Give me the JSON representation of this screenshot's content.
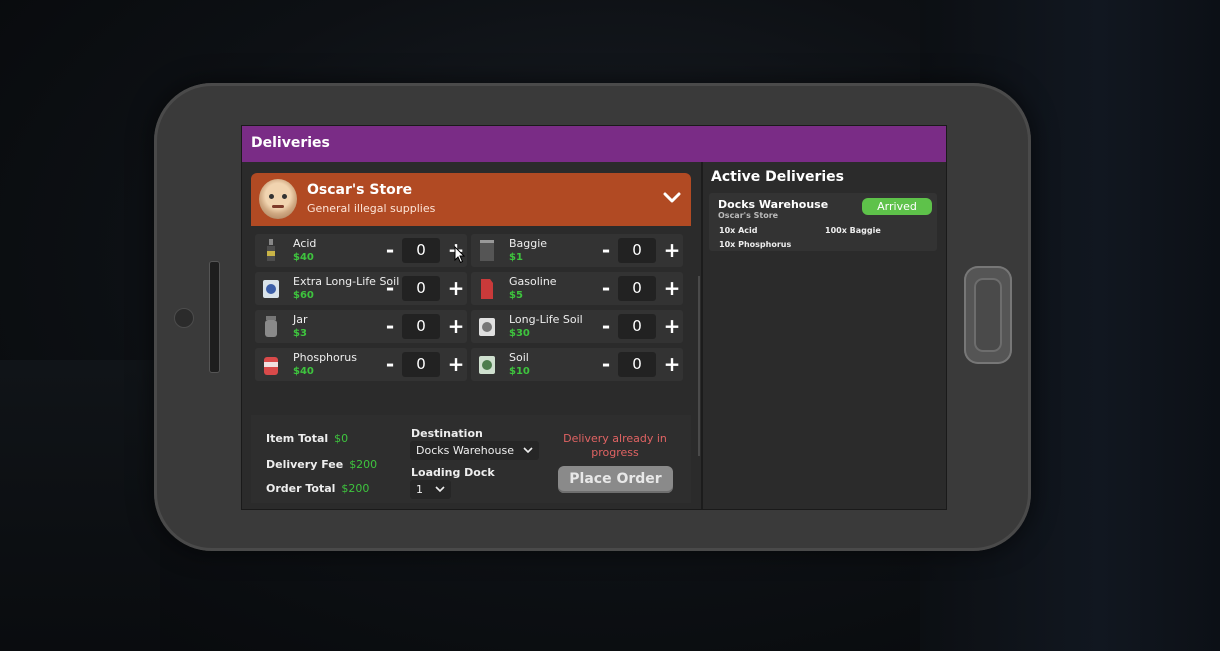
{
  "app": {
    "title": "Deliveries"
  },
  "store": {
    "name": "Oscar's Store",
    "description": "General illegal supplies"
  },
  "items": [
    {
      "name": "Acid",
      "price": "$40",
      "qty": "0",
      "icon": "acid-bottle-icon"
    },
    {
      "name": "Baggie",
      "price": "$1",
      "qty": "0",
      "icon": "baggie-icon"
    },
    {
      "name": "Extra Long-Life Soil",
      "price": "$60",
      "qty": "0",
      "icon": "soil-bag-icon"
    },
    {
      "name": "Gasoline",
      "price": "$5",
      "qty": "0",
      "icon": "gasoline-can-icon"
    },
    {
      "name": "Jar",
      "price": "$3",
      "qty": "0",
      "icon": "jar-icon"
    },
    {
      "name": "Long-Life Soil",
      "price": "$30",
      "qty": "0",
      "icon": "soil-bag-icon"
    },
    {
      "name": "Phosphorus",
      "price": "$40",
      "qty": "0",
      "icon": "phosphorus-tub-icon"
    },
    {
      "name": "Soil",
      "price": "$10",
      "qty": "0",
      "icon": "soil-bag-icon"
    }
  ],
  "controls": {
    "minus": "-",
    "plus": "+"
  },
  "totals": {
    "item_total_label": "Item Total",
    "item_total": "$0",
    "delivery_fee_label": "Delivery Fee",
    "delivery_fee": "$200",
    "order_total_label": "Order Total",
    "order_total": "$200"
  },
  "order": {
    "destination_label": "Destination",
    "destination_value": "Docks Warehouse",
    "loading_dock_label": "Loading Dock",
    "loading_dock_value": "1",
    "warning": "Delivery already in progress",
    "place_order": "Place Order"
  },
  "active": {
    "title": "Active Deliveries",
    "deliveries": [
      {
        "destination": "Docks Warehouse",
        "store": "Oscar's Store",
        "status": "Arrived",
        "items": [
          "10x Acid",
          "100x Baggie",
          "10x Phosphorus"
        ]
      }
    ]
  },
  "colors": {
    "header": "#7a2c86",
    "store": "#b14a23",
    "price": "#3ec43e",
    "status": "#5ec24a",
    "warning": "#e06363"
  }
}
